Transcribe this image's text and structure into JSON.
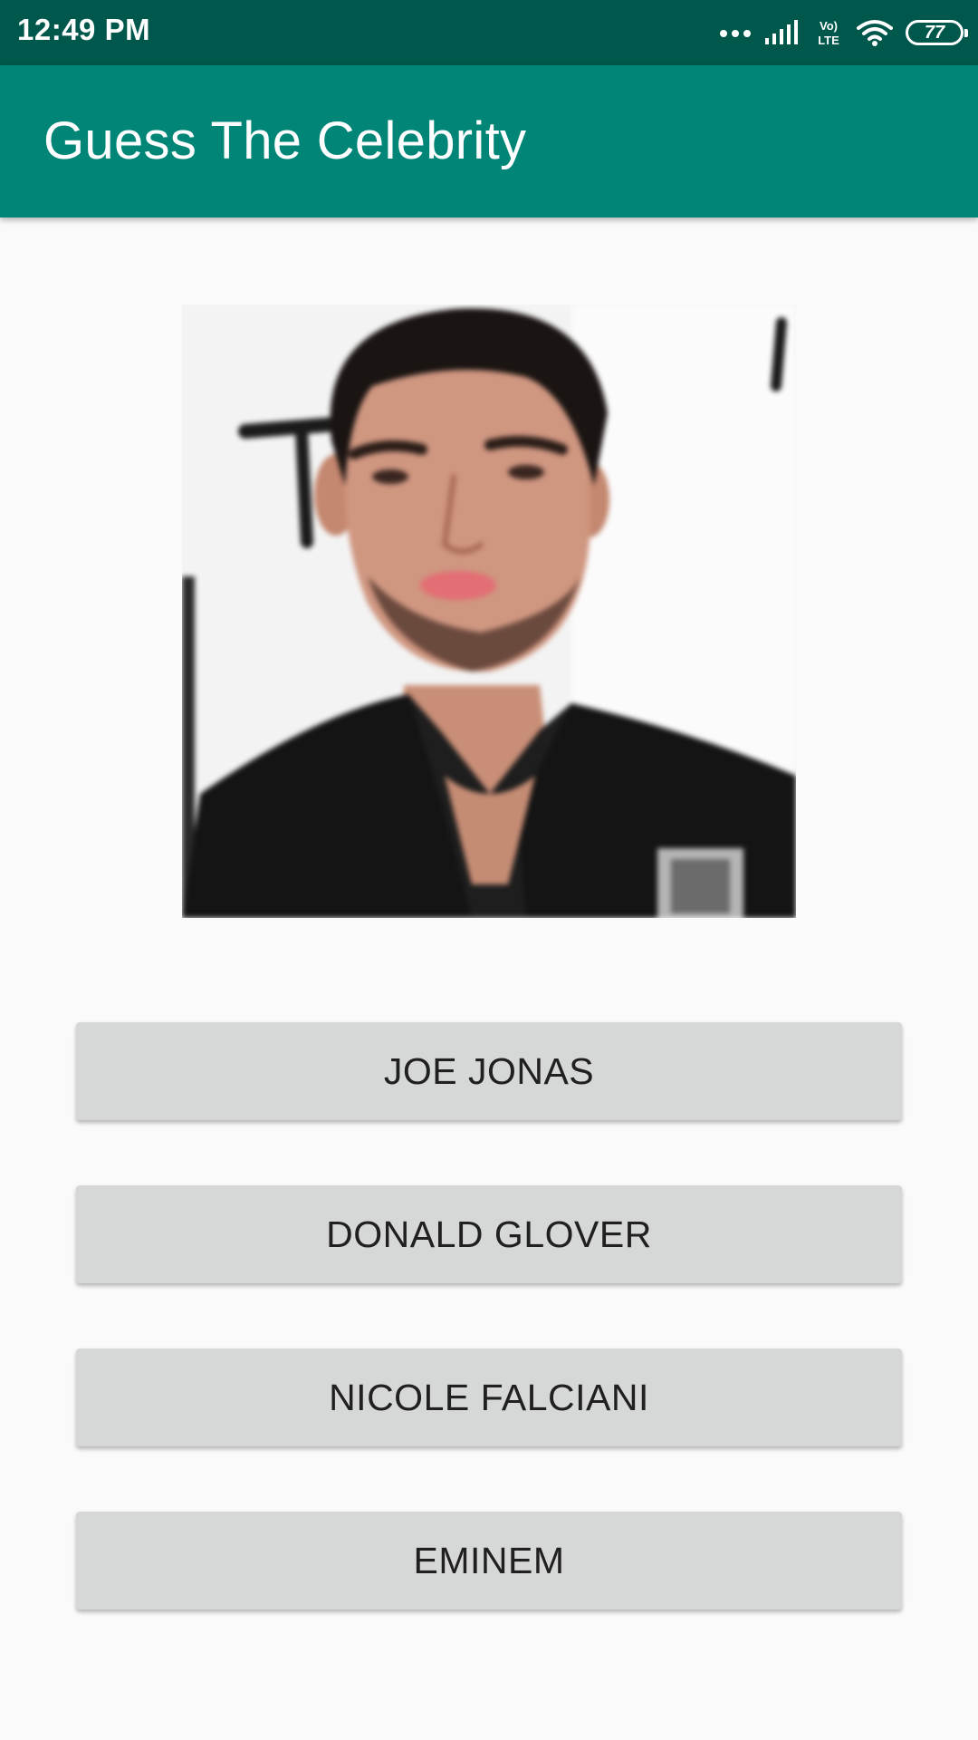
{
  "status_bar": {
    "time": "12:49 PM",
    "network_label": "Vo) LTE",
    "battery_level": "77",
    "icons": [
      "more-dots-icon",
      "signal-icon",
      "volte-icon",
      "wifi-icon",
      "battery-icon"
    ]
  },
  "app_bar": {
    "title": "Guess The Celebrity"
  },
  "celebrity_image": {
    "description_icon": "celebrity-photo"
  },
  "answers": [
    {
      "label": "JOE JONAS"
    },
    {
      "label": "DONALD GLOVER"
    },
    {
      "label": "NICOLE FALCIANI"
    },
    {
      "label": "EMINEM"
    }
  ],
  "colors": {
    "status_bar": "#00574b",
    "app_bar": "#008577",
    "background": "#fafafa",
    "button": "#d6d7d7",
    "button_text": "#202020"
  }
}
